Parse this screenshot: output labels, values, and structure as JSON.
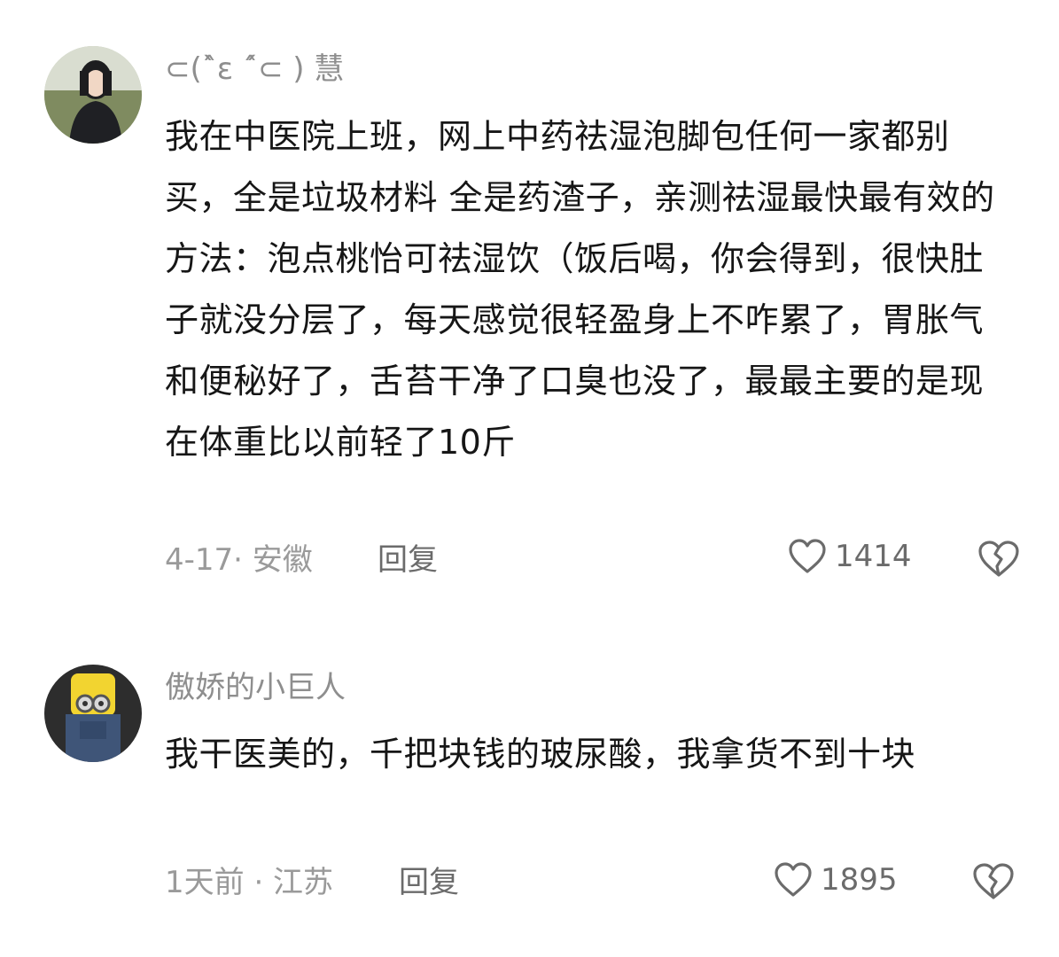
{
  "comments": [
    {
      "username": "⊂(ˆ̀ε ˆ́⊂ ) 慧",
      "text": "我在中医院上班，网上中药祛湿泡脚包任何一家都别买，全是垃圾材料 全是药渣子，亲测祛湿最快最有效的方法：泡点桃怡可祛湿饮（饭后喝，你会得到，很快肚子就没分层了，每天感觉很轻盈身上不咋累了，胃胀气和便秘好了，舌苔干净了口臭也没了，最最主要的是现在体重比以前轻了10斤",
      "meta": "4-17· 安徽",
      "reply_label": "回复",
      "likes": "1414"
    },
    {
      "username": "傲娇的小巨人",
      "text": "我干医美的，千把块钱的玻尿酸，我拿货不到十块",
      "meta": "1天前 · 江苏",
      "reply_label": "回复",
      "likes": "1895"
    }
  ],
  "colors": {
    "text": "#161616",
    "meta": "#9a9a9a",
    "icon": "#6b6b6b",
    "background": "#ffffff"
  },
  "icons": {
    "like": "heart-outline-icon",
    "dislike": "broken-heart-icon"
  }
}
